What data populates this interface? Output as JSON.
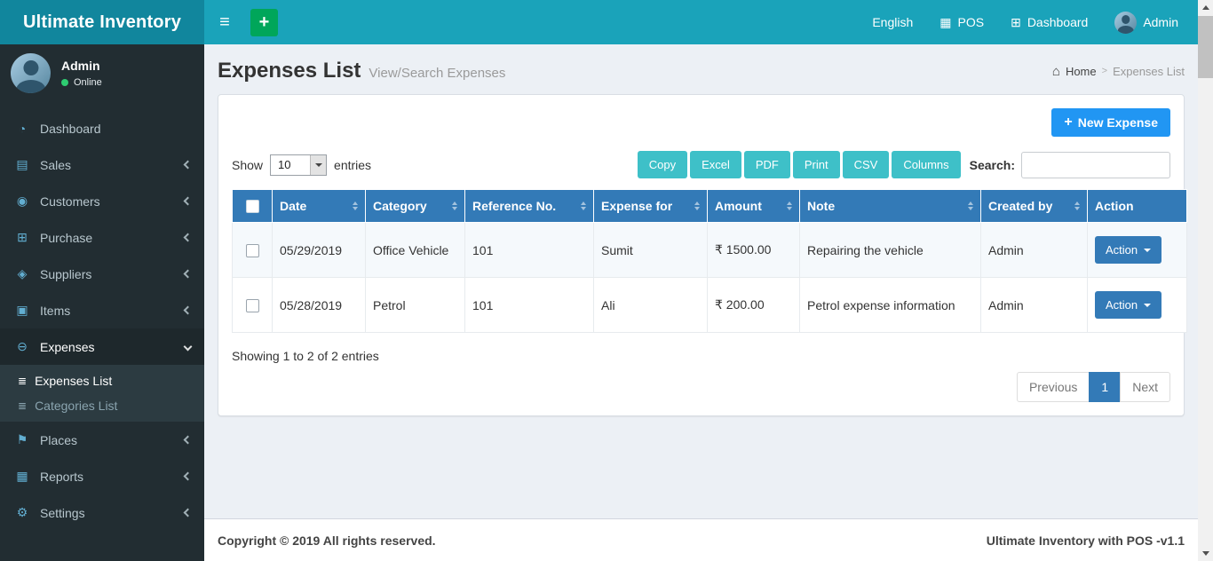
{
  "app": {
    "name": "Ultimate Inventory"
  },
  "icons": {
    "hamburger": "≡",
    "plus": "+",
    "pos": "▦",
    "dashboard_nav": "⊞",
    "home": "⌂"
  },
  "navbar": {
    "language": "English",
    "pos": "POS",
    "dashboard": "Dashboard",
    "user": "Admin"
  },
  "sidebar": {
    "user": {
      "name": "Admin",
      "status": "Online"
    },
    "items": [
      {
        "label": "Dashboard",
        "icon": "◔"
      },
      {
        "label": "Sales",
        "icon": "▤"
      },
      {
        "label": "Customers",
        "icon": "◉"
      },
      {
        "label": "Purchase",
        "icon": "⊞"
      },
      {
        "label": "Suppliers",
        "icon": "◈"
      },
      {
        "label": "Items",
        "icon": "▣"
      },
      {
        "label": "Expenses",
        "icon": "⊖"
      },
      {
        "label": "Places",
        "icon": "⚑"
      },
      {
        "label": "Reports",
        "icon": "▦"
      },
      {
        "label": "Settings",
        "icon": "⚙"
      }
    ],
    "submenu": [
      {
        "label": "Expenses List",
        "icon": "≣"
      },
      {
        "label": "Categories List",
        "icon": "≣"
      }
    ]
  },
  "page": {
    "title": "Expenses List",
    "subtitle": "View/Search Expenses",
    "breadcrumb": {
      "home": "Home",
      "separator": ">",
      "current": "Expenses List"
    }
  },
  "toolbar": {
    "new_expense": "New Expense",
    "show": "Show",
    "page_length": "10",
    "entries": "entries",
    "buttons": [
      "Copy",
      "Excel",
      "PDF",
      "Print",
      "CSV",
      "Columns"
    ],
    "search_label": "Search:",
    "search_value": ""
  },
  "table": {
    "headers": [
      "Date",
      "Category",
      "Reference No.",
      "Expense for",
      "Amount",
      "Note",
      "Created by",
      "Action"
    ],
    "rows": [
      {
        "date": "05/29/2019",
        "category": "Office Vehicle",
        "reference_no": "101",
        "expense_for": "Sumit",
        "amount": "₹ 1500.00",
        "note": "Repairing the vehicle",
        "created_by": "Admin",
        "action": "Action"
      },
      {
        "date": "05/28/2019",
        "category": "Petrol",
        "reference_no": "101",
        "expense_for": "Ali",
        "amount": "₹ 200.00",
        "note": "Petrol expense information",
        "created_by": "Admin",
        "action": "Action"
      }
    ],
    "info": "Showing 1 to 2 of 2 entries",
    "pagination": {
      "previous": "Previous",
      "current": "1",
      "next": "Next"
    }
  },
  "footer": {
    "copyright": "Copyright © 2019 All rights reserved.",
    "version": "Ultimate Inventory with POS -v1.1"
  },
  "colors": {
    "navbar_bg": "#1aa3ba",
    "logo_bg": "#11869d",
    "sidebar_bg": "#222d32",
    "submenu_bg": "#2c3b41",
    "table_header_bg": "#337ab7",
    "export_button_bg": "#3ec0c8",
    "new_expense_button_bg": "#2196f3",
    "action_button_bg": "#337ab7",
    "add_button_bg": "#00a65a",
    "pagination_active_bg": "#337ab7",
    "page_bg": "#ecf0f5",
    "online_dot": "#2ecc71"
  }
}
